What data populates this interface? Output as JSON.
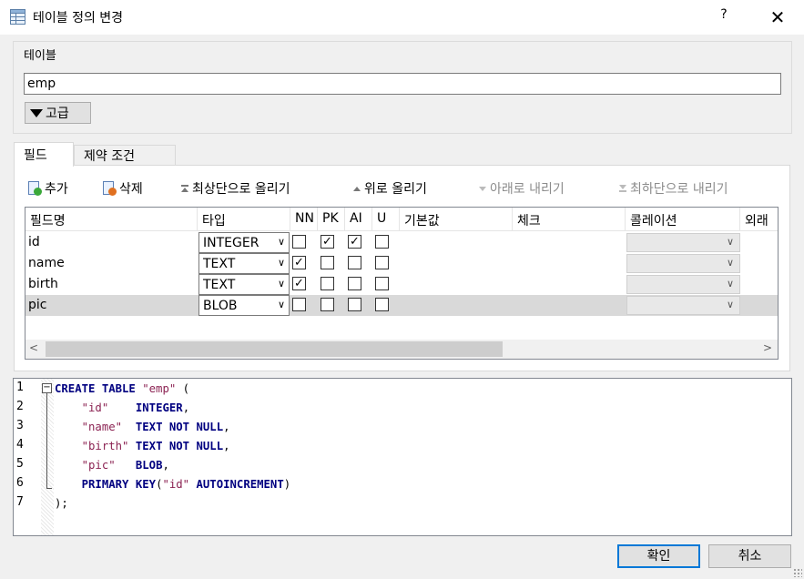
{
  "window": {
    "title": "테이블 정의 변경",
    "help_label": "?",
    "close_label": "✕"
  },
  "table_group": {
    "label": "테이블",
    "name_value": "emp",
    "advanced_label": "고급"
  },
  "tabs": [
    {
      "label": "필드",
      "active": true
    },
    {
      "label": "제약 조건",
      "active": false
    }
  ],
  "toolbar": {
    "add": "추가",
    "delete": "삭제",
    "move_top": "최상단으로 올리기",
    "move_up": "위로 올리기",
    "move_down": "아래로 내리기",
    "move_bottom": "최하단으로 내리기"
  },
  "grid": {
    "headers": [
      "필드명",
      "타입",
      "NN",
      "PK",
      "AI",
      "U",
      "기본값",
      "체크",
      "콜레이션",
      "외래"
    ],
    "rows": [
      {
        "name": "id",
        "type": "INTEGER",
        "nn": false,
        "pk": true,
        "ai": true,
        "u": false
      },
      {
        "name": "name",
        "type": "TEXT",
        "nn": true,
        "pk": false,
        "ai": false,
        "u": false
      },
      {
        "name": "birth",
        "type": "TEXT",
        "nn": true,
        "pk": false,
        "ai": false,
        "u": false
      },
      {
        "name": "pic",
        "type": "BLOB",
        "nn": false,
        "pk": false,
        "ai": false,
        "u": false
      }
    ],
    "selected_row": 3
  },
  "sql": {
    "line_numbers": [
      "1",
      "2",
      "3",
      "4",
      "5",
      "6",
      "7"
    ],
    "lines": [
      [
        {
          "t": "kw",
          "v": "CREATE TABLE "
        },
        {
          "t": "str",
          "v": "\"emp\""
        },
        {
          "t": "punc",
          "v": " ("
        }
      ],
      [
        {
          "t": "punc",
          "v": "    "
        },
        {
          "t": "str",
          "v": "\"id\""
        },
        {
          "t": "punc",
          "v": "    "
        },
        {
          "t": "kw",
          "v": "INTEGER"
        },
        {
          "t": "punc",
          "v": ","
        }
      ],
      [
        {
          "t": "punc",
          "v": "    "
        },
        {
          "t": "str",
          "v": "\"name\""
        },
        {
          "t": "punc",
          "v": "  "
        },
        {
          "t": "kw",
          "v": "TEXT NOT NULL"
        },
        {
          "t": "punc",
          "v": ","
        }
      ],
      [
        {
          "t": "punc",
          "v": "    "
        },
        {
          "t": "str",
          "v": "\"birth\""
        },
        {
          "t": "punc",
          "v": " "
        },
        {
          "t": "kw",
          "v": "TEXT NOT NULL"
        },
        {
          "t": "punc",
          "v": ","
        }
      ],
      [
        {
          "t": "punc",
          "v": "    "
        },
        {
          "t": "str",
          "v": "\"pic\""
        },
        {
          "t": "punc",
          "v": "   "
        },
        {
          "t": "kw",
          "v": "BLOB"
        },
        {
          "t": "punc",
          "v": ","
        }
      ],
      [
        {
          "t": "punc",
          "v": "    "
        },
        {
          "t": "kw",
          "v": "PRIMARY KEY"
        },
        {
          "t": "punc",
          "v": "("
        },
        {
          "t": "str",
          "v": "\"id\""
        },
        {
          "t": "punc",
          "v": " "
        },
        {
          "t": "kw",
          "v": "AUTOINCREMENT"
        },
        {
          "t": "punc",
          "v": ")"
        }
      ],
      [
        {
          "t": "punc",
          "v": ");"
        }
      ]
    ]
  },
  "buttons": {
    "ok": "확인",
    "cancel": "취소"
  },
  "colors": {
    "accent": "#0078d7",
    "keyword": "#000080",
    "string": "#8b2252"
  }
}
